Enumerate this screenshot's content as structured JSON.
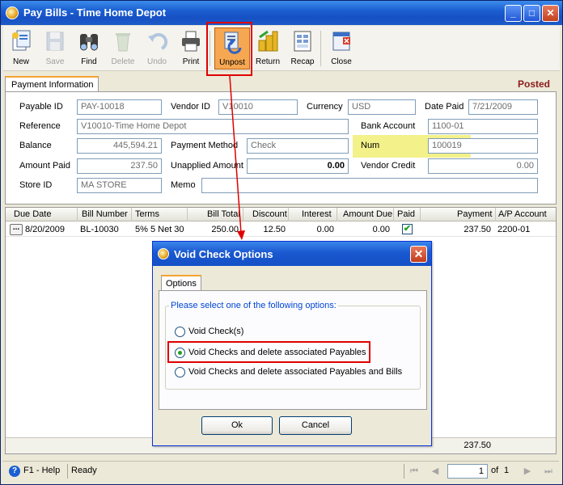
{
  "window": {
    "title": "Pay Bills - Time Home Depot",
    "buttons": {
      "minimize": "_",
      "maximize": "□",
      "close": "✕"
    }
  },
  "toolbar": {
    "items": [
      {
        "label": "New",
        "icon": "new-icon",
        "enabled": true
      },
      {
        "label": "Save",
        "icon": "save-icon",
        "enabled": false
      },
      {
        "label": "Find",
        "icon": "find-icon",
        "enabled": true
      },
      {
        "label": "Delete",
        "icon": "delete-icon",
        "enabled": false
      },
      {
        "label": "Undo",
        "icon": "undo-icon",
        "enabled": false
      },
      {
        "label": "Print",
        "icon": "print-icon",
        "enabled": true
      },
      {
        "label": "Unpost",
        "icon": "unpost-icon",
        "enabled": true,
        "active": true
      },
      {
        "label": "Return",
        "icon": "return-icon",
        "enabled": true
      },
      {
        "label": "Recap",
        "icon": "recap-icon",
        "enabled": true
      },
      {
        "label": "Close",
        "icon": "close-doc-icon",
        "enabled": true
      }
    ]
  },
  "form": {
    "tab": "Payment Information",
    "status": "Posted",
    "payable_id": {
      "label": "Payable ID",
      "value": "PAY-10018"
    },
    "vendor_id": {
      "label": "Vendor ID",
      "value": "V10010"
    },
    "currency": {
      "label": "Currency",
      "value": "USD"
    },
    "date_paid": {
      "label": "Date Paid",
      "value": "7/21/2009"
    },
    "reference": {
      "label": "Reference",
      "value": "V10010-Time Home Depot"
    },
    "bank_account": {
      "label": "Bank Account",
      "value": "1100-01"
    },
    "balance": {
      "label": "Balance",
      "value": "445,594.21"
    },
    "payment_method": {
      "label": "Payment Method",
      "value": "Check"
    },
    "num": {
      "label": "Num",
      "value": "100019"
    },
    "amount_paid": {
      "label": "Amount Paid",
      "value": "237.50"
    },
    "unapplied_amount": {
      "label": "Unapplied Amount",
      "value": "0.00"
    },
    "vendor_credit": {
      "label": "Vendor Credit",
      "value": "0.00"
    },
    "store_id": {
      "label": "Store ID",
      "value": "MA STORE"
    },
    "memo": {
      "label": "Memo",
      "value": ""
    }
  },
  "grid": {
    "columns": [
      "Due Date",
      "Bill Number",
      "Terms",
      "Bill Total",
      "Discount",
      "Interest",
      "Amount Due",
      "Paid",
      "Payment",
      "A/P Account"
    ],
    "rows": [
      {
        "due_date": "8/20/2009",
        "bill_number": "BL-10030",
        "terms": "5% 5 Net 30",
        "bill_total": "250.00",
        "discount": "12.50",
        "interest": "0.00",
        "amount_due": "0.00",
        "paid": true,
        "payment": "237.50",
        "ap_account": "2200-01"
      }
    ],
    "footer_total": "237.50"
  },
  "statusbar": {
    "help": "F1 - Help",
    "status": "Ready",
    "page": "1",
    "of_label": "of",
    "total_pages": "1"
  },
  "dialog": {
    "title": "Void Check Options",
    "tab": "Options",
    "group_label": "Please select one of the following options:",
    "options": [
      {
        "label": "Void Check(s)",
        "selected": false
      },
      {
        "label": "Void Checks and delete associated Payables",
        "selected": true
      },
      {
        "label": "Void Checks and delete associated Payables and Bills",
        "selected": false
      }
    ],
    "ok_label": "Ok",
    "cancel_label": "Cancel"
  },
  "colors": {
    "title_bar": "#1b5fd2",
    "highlight": "#f3f18a",
    "annotation_red": "#e00000",
    "posted": "#8b1a1a"
  }
}
